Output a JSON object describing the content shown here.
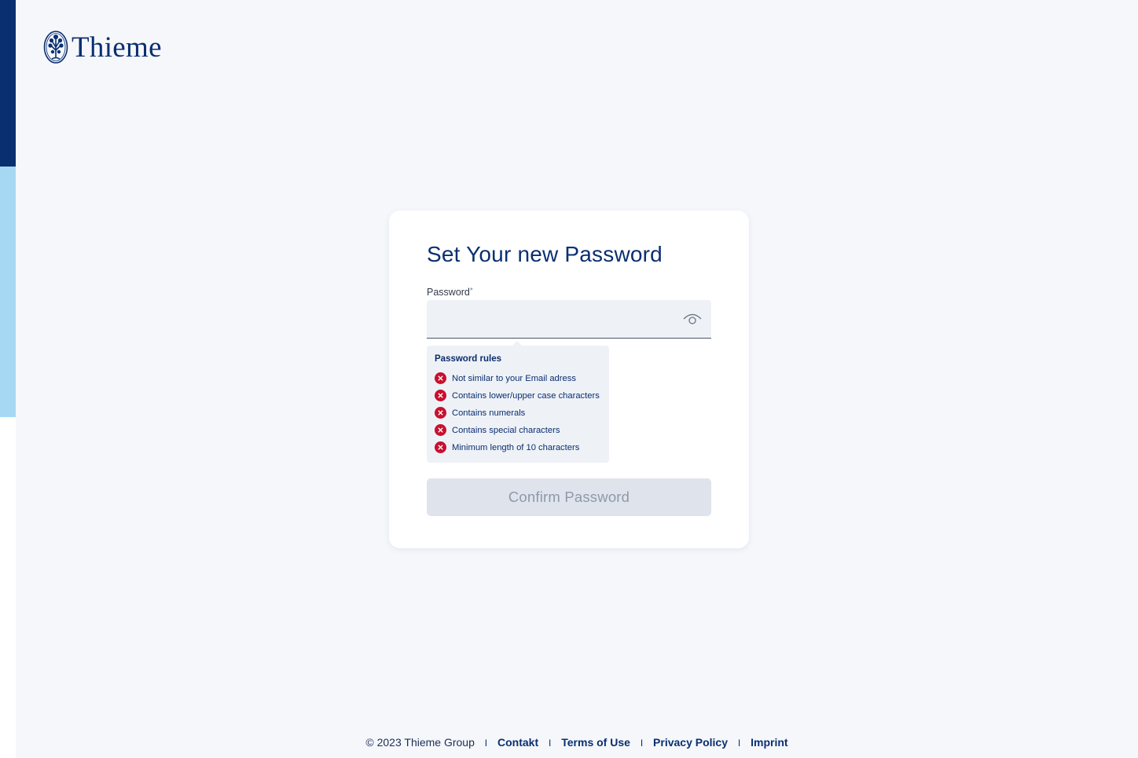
{
  "brand": {
    "name": "Thieme",
    "primary_color": "#0a2f70",
    "accent_light": "#a6d8f3",
    "error_color": "#c8102e"
  },
  "form": {
    "title": "Set Your new Password",
    "password_label": "Password",
    "required_marker": "*",
    "password_value": "",
    "toggle_icon": "eye-icon",
    "rules_title": "Password rules",
    "rules": [
      {
        "label": "Not similar to your Email adress",
        "status": "failed"
      },
      {
        "label": "Contains lower/upper case characters",
        "status": "failed"
      },
      {
        "label": "Contains numerals",
        "status": "failed"
      },
      {
        "label": "Contains special characters",
        "status": "failed"
      },
      {
        "label": "Minimum length of 10 characters",
        "status": "failed"
      }
    ],
    "submit_label": "Confirm Password",
    "submit_state": "disabled"
  },
  "footer": {
    "copyright": "© 2023 Thieme Group",
    "separator": "I",
    "links": [
      "Contakt",
      "Terms of Use",
      "Privacy Policy",
      "Imprint"
    ]
  }
}
